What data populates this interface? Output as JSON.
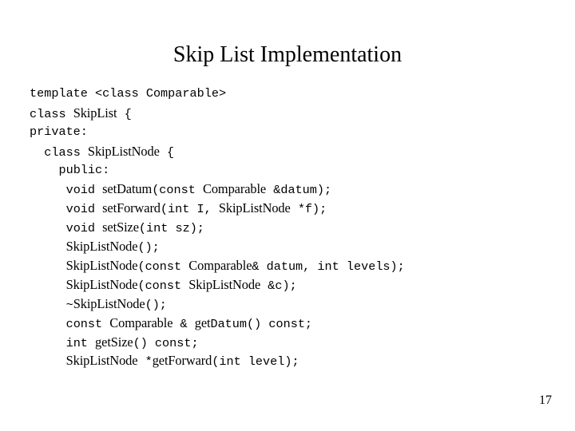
{
  "slide": {
    "title": "Skip List Implementation",
    "page_number": "17",
    "background_color": "#ffffff",
    "text_color": "#000000"
  },
  "code": {
    "language": "cpp",
    "lines": [
      {
        "indent": "",
        "segments": [
          {
            "text": "template <class Comparable>",
            "style": "mono"
          }
        ],
        "plain": "template <class Comparable>"
      },
      {
        "indent": "",
        "segments": [
          {
            "text": "class ",
            "style": "mono"
          },
          {
            "text": "SkipList",
            "style": "ident"
          },
          {
            "text": " {",
            "style": "mono"
          }
        ],
        "plain": "class SkipList {"
      },
      {
        "indent": "",
        "segments": [
          {
            "text": "private:",
            "style": "mono"
          }
        ],
        "plain": "private:"
      },
      {
        "indent": "  ",
        "segments": [
          {
            "text": "class ",
            "style": "mono"
          },
          {
            "text": "SkipListNode",
            "style": "ident"
          },
          {
            "text": " {",
            "style": "mono"
          }
        ],
        "plain": "  class SkipListNode {"
      },
      {
        "indent": "    ",
        "segments": [
          {
            "text": "public:",
            "style": "mono"
          }
        ],
        "plain": "    public:"
      },
      {
        "indent": "     ",
        "segments": [
          {
            "text": "void ",
            "style": "mono"
          },
          {
            "text": "setDatum",
            "style": "ident"
          },
          {
            "text": "(const ",
            "style": "mono"
          },
          {
            "text": "Comparable",
            "style": "ident"
          },
          {
            "text": " &datum);",
            "style": "mono"
          }
        ],
        "plain": "     void setDatum(const Comparable &datum);"
      },
      {
        "indent": "     ",
        "segments": [
          {
            "text": "void ",
            "style": "mono"
          },
          {
            "text": "setForward",
            "style": "ident"
          },
          {
            "text": "(int I, ",
            "style": "mono"
          },
          {
            "text": "SkipListNode",
            "style": "ident"
          },
          {
            "text": " *f);",
            "style": "mono"
          }
        ],
        "plain": "     void setForward(int I, SkipListNode *f);"
      },
      {
        "indent": "     ",
        "segments": [
          {
            "text": "void ",
            "style": "mono"
          },
          {
            "text": "setSize",
            "style": "ident"
          },
          {
            "text": "(int sz);",
            "style": "mono"
          }
        ],
        "plain": "     void setSize(int sz);"
      },
      {
        "indent": "     ",
        "segments": [
          {
            "text": "SkipListNode",
            "style": "ident"
          },
          {
            "text": "();",
            "style": "mono"
          }
        ],
        "plain": "     SkipListNode();"
      },
      {
        "indent": "     ",
        "segments": [
          {
            "text": "SkipListNode",
            "style": "ident"
          },
          {
            "text": "(const ",
            "style": "mono"
          },
          {
            "text": "Comparable",
            "style": "ident"
          },
          {
            "text": "& datum, int levels);",
            "style": "mono"
          }
        ],
        "plain": "     SkipListNode(const Comparable& datum, int levels);"
      },
      {
        "indent": "     ",
        "segments": [
          {
            "text": "SkipListNode",
            "style": "ident"
          },
          {
            "text": "(const ",
            "style": "mono"
          },
          {
            "text": "SkipListNode",
            "style": "ident"
          },
          {
            "text": " &c);",
            "style": "mono"
          }
        ],
        "plain": "     SkipListNode(const SkipListNode &c);"
      },
      {
        "indent": "     ",
        "segments": [
          {
            "text": "~",
            "style": "mono"
          },
          {
            "text": "SkipListNode",
            "style": "ident"
          },
          {
            "text": "();",
            "style": "mono"
          }
        ],
        "plain": "     ~SkipListNode();"
      },
      {
        "indent": "     ",
        "segments": [
          {
            "text": "const ",
            "style": "mono"
          },
          {
            "text": "Comparable",
            "style": "ident"
          },
          {
            "text": " & ",
            "style": "mono"
          },
          {
            "text": "get",
            "style": "ident"
          },
          {
            "text": "Datum() const;",
            "style": "mono"
          }
        ],
        "plain": "     const Comparable & getDatum() const;"
      },
      {
        "indent": "     ",
        "segments": [
          {
            "text": "int ",
            "style": "mono"
          },
          {
            "text": "getSize",
            "style": "ident"
          },
          {
            "text": "() const;",
            "style": "mono"
          }
        ],
        "plain": "     int getSize() const;"
      },
      {
        "indent": "     ",
        "segments": [
          {
            "text": "SkipListNode",
            "style": "ident"
          },
          {
            "text": " *",
            "style": "mono"
          },
          {
            "text": "getForward",
            "style": "ident"
          },
          {
            "text": "(int level);",
            "style": "mono"
          }
        ],
        "plain": "     SkipListNode *getForward(int level);"
      }
    ]
  }
}
